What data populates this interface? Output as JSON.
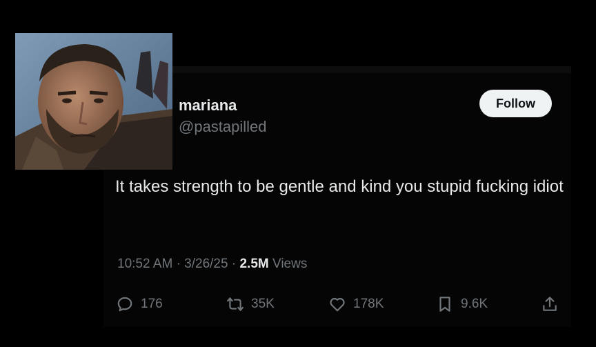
{
  "user": {
    "display_name": "mariana",
    "handle": "@pastapilled",
    "follow_label": "Follow"
  },
  "tweet": {
    "text": "It takes strength to be gentle and kind you stupid fucking idiot",
    "time": "10:52 AM",
    "date": "3/26/25",
    "views_count": "2.5M",
    "views_label": "Views"
  },
  "actions": {
    "replies": "176",
    "reposts": "35K",
    "likes": "178K",
    "bookmarks": "9.6K"
  },
  "icons": [
    "reply-icon",
    "repost-icon",
    "like-icon",
    "bookmark-icon",
    "share-icon"
  ],
  "colors": {
    "background": "#000000",
    "text_primary": "#e7e9ea",
    "text_secondary": "#71767b",
    "follow_button_bg": "#eff3f4"
  }
}
